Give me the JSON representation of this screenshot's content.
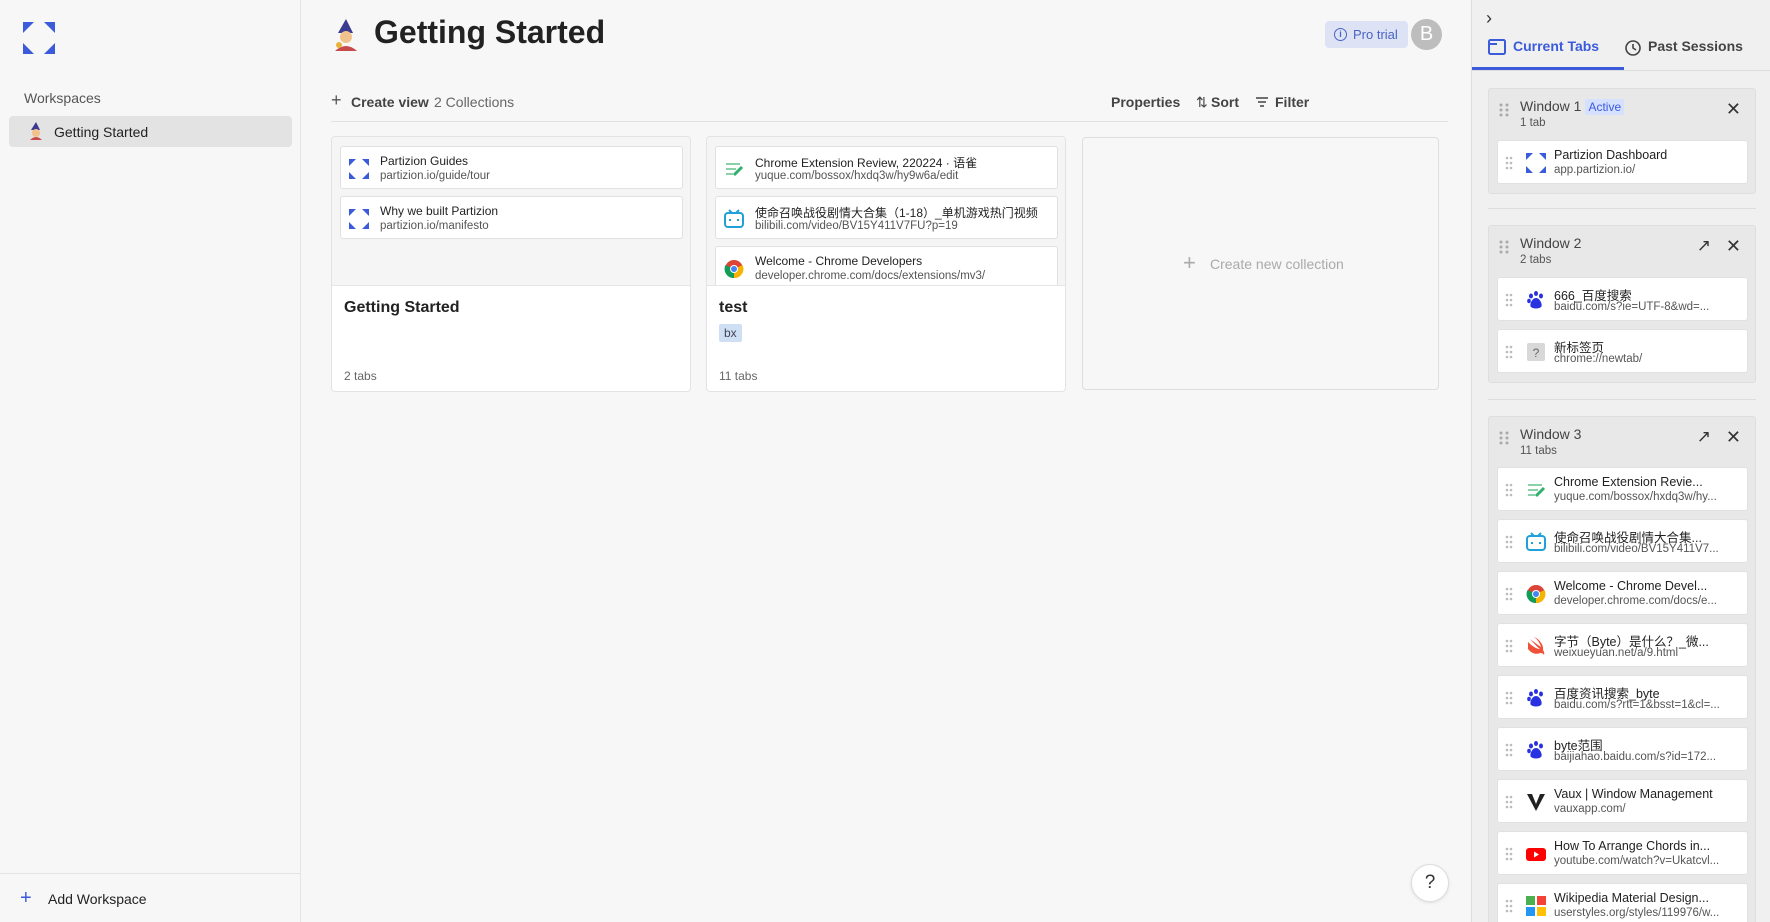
{
  "sidebar": {
    "workspaces_label": "Workspaces",
    "workspace_item": "Getting Started",
    "add_workspace": "Add Workspace"
  },
  "main": {
    "title": "Getting Started",
    "pro_badge": "Pro trial",
    "avatar_letter": "B",
    "toolbar": {
      "create_view": "Create view",
      "collections_count": "2 Collections",
      "properties": "Properties",
      "sort": "Sort",
      "filter": "Filter"
    },
    "collections": [
      {
        "name": "Getting Started",
        "count": "2 tabs",
        "tabs": [
          {
            "title": "Partizion Guides",
            "url": "partizion.io/guide/tour",
            "icon": "partizion-icon"
          },
          {
            "title": "Why we built Partizion",
            "url": "partizion.io/manifesto",
            "icon": "partizion-icon"
          }
        ]
      },
      {
        "name": "test",
        "tag": "bx",
        "count": "11 tabs",
        "tabs": [
          {
            "title": "Chrome Extension Review, 220224 · 语雀",
            "url": "yuque.com/bossox/hxdq3w/hy9w6a/edit",
            "icon": "yuque-icon"
          },
          {
            "title": "使命召唤战役剧情大合集（1-18）_单机游戏热门视频",
            "url": "bilibili.com/video/BV15Y411V7FU?p=19",
            "icon": "bilibili-icon"
          },
          {
            "title": "Welcome - Chrome Developers",
            "url": "developer.chrome.com/docs/extensions/mv3/",
            "icon": "chrome-icon"
          }
        ]
      }
    ],
    "new_collection": "Create new collection",
    "help": "?"
  },
  "panel": {
    "tabs": {
      "current": "Current Tabs",
      "past": "Past Sessions"
    },
    "windows": [
      {
        "name": "Window 1",
        "active_label": "Active",
        "count": "1 tab",
        "tabs": [
          {
            "title": "Partizion Dashboard",
            "url": "app.partizion.io/",
            "icon": "partizion-icon"
          }
        ]
      },
      {
        "name": "Window 2",
        "count": "2 tabs",
        "tabs": [
          {
            "title": "666_百度搜索",
            "url": "baidu.com/s?ie=UTF-8&wd=...",
            "icon": "baidu-icon"
          },
          {
            "title": "新标签页",
            "url": "chrome://newtab/",
            "icon": "unknown-page-icon"
          }
        ]
      },
      {
        "name": "Window 3",
        "count": "11 tabs",
        "tabs": [
          {
            "title": "Chrome Extension Revie...",
            "url": "yuque.com/bossox/hxdq3w/hy...",
            "icon": "yuque-icon"
          },
          {
            "title": "使命召唤战役剧情大合集...",
            "url": "bilibili.com/video/BV15Y411V7...",
            "icon": "bilibili-icon"
          },
          {
            "title": "Welcome - Chrome Devel...",
            "url": "developer.chrome.com/docs/e...",
            "icon": "chrome-icon"
          },
          {
            "title": "字节（Byte）是什么？_微...",
            "url": "weixueyuan.net/a/9.html",
            "icon": "swift-icon"
          },
          {
            "title": "百度资讯搜索_byte",
            "url": "baidu.com/s?rtt=1&bsst=1&cl=...",
            "icon": "baidu-icon"
          },
          {
            "title": "byte范围",
            "url": "baijiahao.baidu.com/s?id=172...",
            "icon": "baidu-icon"
          },
          {
            "title": "Vaux | Window Management",
            "url": "vauxapp.com/",
            "icon": "vaux-icon"
          },
          {
            "title": "How To Arrange Chords in...",
            "url": "youtube.com/watch?v=Ukatcvl...",
            "icon": "youtube-icon"
          },
          {
            "title": "Wikipedia Material Design...",
            "url": "userstyles.org/styles/119976/w...",
            "icon": "userstyles-icon"
          }
        ]
      }
    ]
  }
}
